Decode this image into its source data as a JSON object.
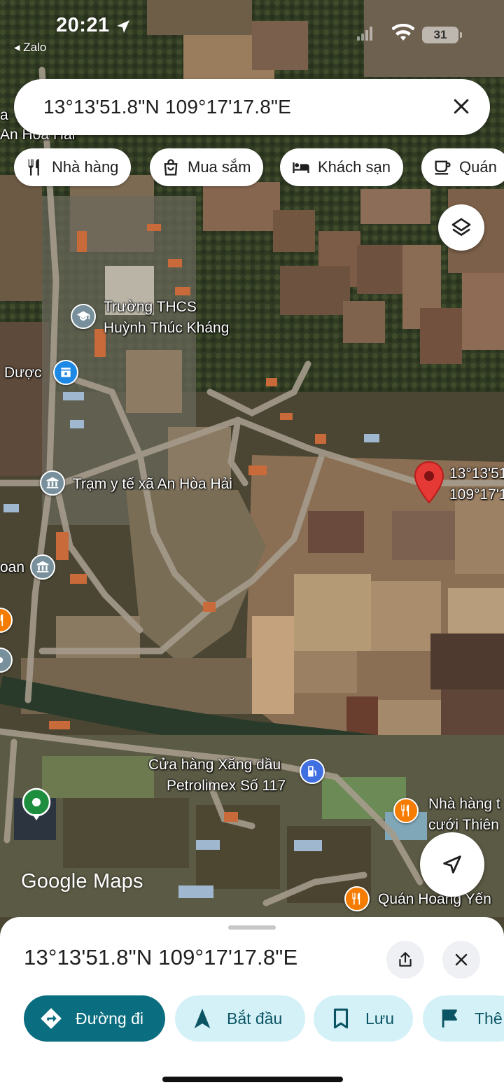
{
  "status_bar": {
    "time": "20:21",
    "back_app": "Zalo",
    "battery": "31"
  },
  "search": {
    "query": "13°13'51.8\"N 109°17'17.8\"E",
    "clear_icon": "close-icon"
  },
  "chips": [
    {
      "label": "Nhà hàng",
      "icon": "fork-knife-icon"
    },
    {
      "label": "Mua sắm",
      "icon": "shopping-bag-icon"
    },
    {
      "label": "Khách sạn",
      "icon": "bed-icon"
    },
    {
      "label": "Quán",
      "icon": "cup-icon"
    }
  ],
  "map": {
    "labels": {
      "school_line1": "Trường THCS",
      "school_line2": "Huỳnh Thúc Kháng",
      "pharmacy": "Dược",
      "health_station": "Trạm y tế xã An Hòa Hải",
      "partial_left": "oan",
      "top_left_a": "a",
      "top_left_b": "An Hòa Hải",
      "coord_line1": "13°13'51.",
      "coord_line2": "109°17'1",
      "gas_line1": "Cửa hàng Xăng dầu",
      "gas_line2": "Petrolimex Số 117",
      "restaurant_line1": "Nhà hàng t",
      "restaurant_line2": "cưới Thiên",
      "quan": "Quán Hoàng Yến"
    },
    "logo": "Google Maps",
    "colors": {
      "pin_red": "#e53935",
      "poi_gray": "#78909c",
      "poi_blue": "#1e88e5",
      "poi_orange": "#f57c00",
      "poi_green": "#1e8e3e",
      "gas_blue": "#3f6fe0"
    }
  },
  "sheet": {
    "title": "13°13'51.8\"N 109°17'17.8\"E",
    "actions": [
      {
        "label": "Đường đi",
        "icon": "directions-icon"
      },
      {
        "label": "Bắt đầu",
        "icon": "navigation-arrow-icon"
      },
      {
        "label": "Lưu",
        "icon": "bookmark-icon"
      },
      {
        "label": "Thê",
        "icon": "flag-icon"
      }
    ]
  }
}
